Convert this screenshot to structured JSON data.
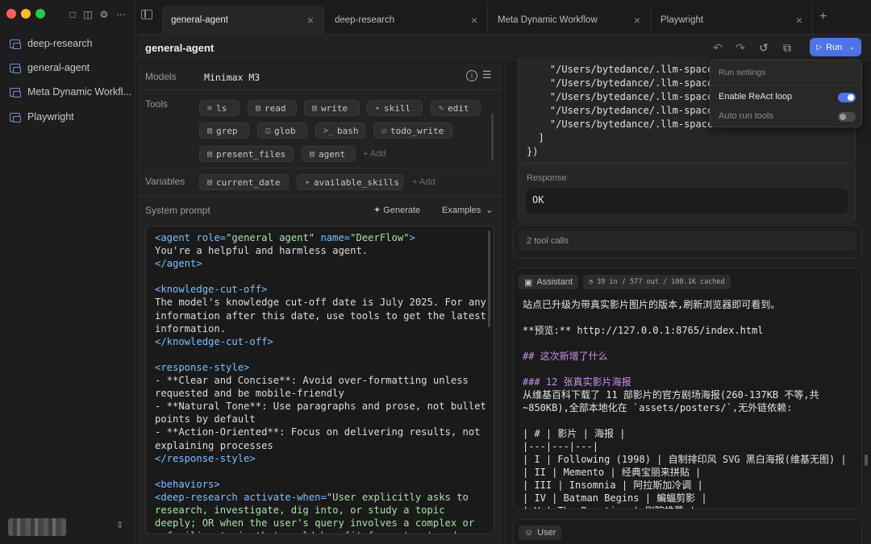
{
  "sidebar": {
    "items": [
      {
        "label": "deep-research"
      },
      {
        "label": "general-agent"
      },
      {
        "label": "Meta Dynamic Workfl..."
      },
      {
        "label": "Playwright"
      }
    ]
  },
  "tabs": [
    {
      "label": "general-agent"
    },
    {
      "label": "deep-research"
    },
    {
      "label": "Meta Dynamic Workflow"
    },
    {
      "label": "Playwright"
    }
  ],
  "header": {
    "title": "general-agent",
    "run_label": "Run"
  },
  "form": {
    "models_label": "Models",
    "model_value": "Minimax M3",
    "tools_label": "Tools",
    "tools": [
      "ls",
      "read",
      "write",
      "skill",
      "edit",
      "grep",
      "glob",
      "bash",
      "todo_write",
      "present_files",
      "agent"
    ],
    "add_label": "Add",
    "variables_label": "Variables",
    "variables": [
      "current_date",
      "available_skills"
    ],
    "system_prompt_label": "System prompt",
    "generate_label": "Generate",
    "examples_label": "Examples"
  },
  "prompt_lines": [
    [
      {
        "t": "<agent ",
        "c": "tag"
      },
      {
        "t": "role=",
        "c": "attr"
      },
      {
        "t": "\"general agent\"",
        "c": "str"
      },
      {
        "t": " name=",
        "c": "attr"
      },
      {
        "t": "\"DeerFlow\"",
        "c": "str"
      },
      {
        "t": ">",
        "c": "tag"
      }
    ],
    [
      {
        "t": "You're a helpful and harmless agent.",
        "c": ""
      }
    ],
    [
      {
        "t": "</agent>",
        "c": "tag"
      }
    ],
    [
      {
        "t": "",
        "c": ""
      }
    ],
    [
      {
        "t": "<knowledge-cut-off>",
        "c": "tag"
      }
    ],
    [
      {
        "t": "The model's knowledge cut-off date is July 2025. For any",
        "c": ""
      }
    ],
    [
      {
        "t": "information after this date, use tools to get the latest",
        "c": ""
      }
    ],
    [
      {
        "t": "information.",
        "c": ""
      }
    ],
    [
      {
        "t": "</knowledge-cut-off>",
        "c": "tag"
      }
    ],
    [
      {
        "t": "",
        "c": ""
      }
    ],
    [
      {
        "t": "<response-style>",
        "c": "tag"
      }
    ],
    [
      {
        "t": "- **Clear and Concise**: Avoid over-formatting unless",
        "c": ""
      }
    ],
    [
      {
        "t": "requested and be mobile-friendly",
        "c": ""
      }
    ],
    [
      {
        "t": "- **Natural Tone**: Use paragraphs and prose, not bullet",
        "c": ""
      }
    ],
    [
      {
        "t": "points by default",
        "c": ""
      }
    ],
    [
      {
        "t": "- **Action-Oriented**: Focus on delivering results, not",
        "c": ""
      }
    ],
    [
      {
        "t": "explaining processes",
        "c": ""
      }
    ],
    [
      {
        "t": "</response-style>",
        "c": "tag"
      }
    ],
    [
      {
        "t": "",
        "c": ""
      }
    ],
    [
      {
        "t": "<behaviors>",
        "c": "tag"
      }
    ],
    [
      {
        "t": "<deep-research ",
        "c": "tag"
      },
      {
        "t": "activate-when=",
        "c": "attr"
      },
      {
        "t": "\"User explicitly asks to",
        "c": "str"
      }
    ],
    [
      {
        "t": "research, investigate, dig into, or study a topic",
        "c": "str"
      }
    ],
    [
      {
        "t": "deeply; OR when the user's query involves a complex or",
        "c": "str"
      }
    ],
    [
      {
        "t": "unfamiliar topic that would benefit from structured",
        "c": "str"
      }
    ]
  ],
  "tool_output": {
    "lines": [
      "    \"/Users/bytedance/.llm-space",
      "    \"/Users/bytedance/.llm-space",
      "    \"/Users/bytedance/.llm-space",
      "    \"/Users/bytedance/.llm-space",
      "    \"/Users/bytedance/.llm-space",
      "  ]",
      "})"
    ],
    "response_label": "Response",
    "response_value": "OK",
    "tool_calls": "2 tool calls"
  },
  "assistant": {
    "role": "Assistant",
    "stats": "39 in / 577 out / 100.1K cached",
    "lines": [
      {
        "t": "站点已升级为带真实影片图片的版本,刷新浏览器即可看到。",
        "h": false
      },
      {
        "t": "",
        "h": false
      },
      {
        "t": "**预览:** http://127.0.0.1:8765/index.html",
        "h": false
      },
      {
        "t": "",
        "h": false
      },
      {
        "t": "## 这次新增了什么",
        "h": true
      },
      {
        "t": "",
        "h": false
      },
      {
        "t": "### 12 张真实影片海报",
        "h": true
      },
      {
        "t": "从维基百科下载了 11 部影片的官方剧场海报(260-137KB 不等,共",
        "h": false
      },
      {
        "t": "~850KB),全部本地化在 `assets/posters/`,无外链依赖:",
        "h": false
      },
      {
        "t": "",
        "h": false
      },
      {
        "t": "| # | 影片 | 海报 |",
        "h": false
      },
      {
        "t": "|---|---|---|",
        "h": false
      },
      {
        "t": "| I | Following (1998) | 自制排印风 SVG 黑白海报(维基无图) |",
        "h": false
      },
      {
        "t": "| II | Memento | 经典宝丽来拼贴 |",
        "h": false
      },
      {
        "t": "| III | Insomnia | 阿拉斯加冷调 |",
        "h": false
      },
      {
        "t": "| IV | Batman Begins | 蝙蝠剪影 |",
        "h": false
      },
      {
        "t": "| V | The Prestige | 剧院帷幕 |",
        "h": false
      }
    ]
  },
  "user": {
    "role": "User"
  },
  "popup": {
    "title": "Run settings",
    "react_label": "Enable ReAct loop",
    "react_enabled": 1,
    "auto_label": "Auto run tools",
    "auto_enabled": 0
  }
}
